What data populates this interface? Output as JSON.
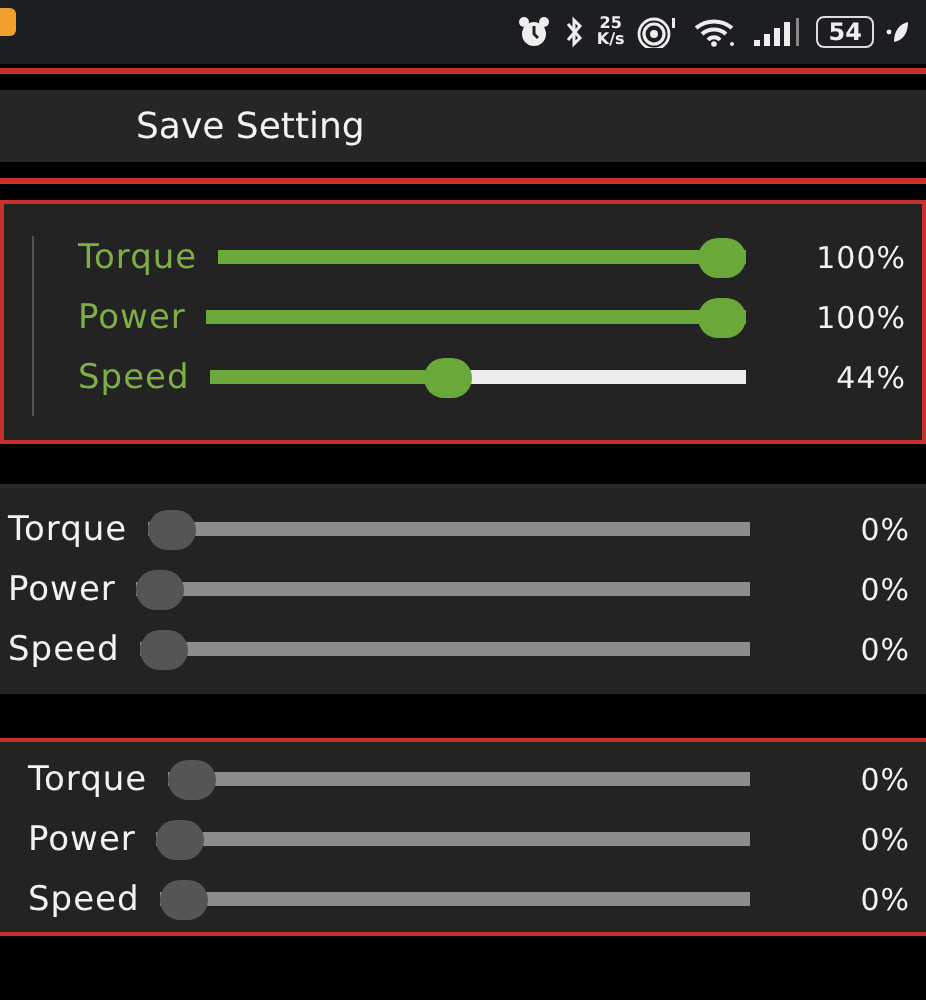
{
  "status_bar": {
    "net_speed_value": "25",
    "net_speed_unit": "K/s",
    "battery": "54"
  },
  "save_button": {
    "label": "Save Setting"
  },
  "groups": [
    {
      "enabled": true,
      "sliders": [
        {
          "label": "Torque",
          "level": 1,
          "reading": "100%"
        },
        {
          "label": "Power",
          "level": 1,
          "reading": "100%"
        },
        {
          "label": "Speed",
          "level": 0.44,
          "reading": "44%"
        }
      ]
    },
    {
      "enabled": false,
      "sliders": [
        {
          "label": "Torque",
          "level": 0,
          "reading": "0%"
        },
        {
          "label": "Power",
          "level": 0,
          "reading": "0%"
        },
        {
          "label": "Speed",
          "level": 0,
          "reading": "0%"
        }
      ]
    },
    {
      "enabled": false,
      "sliders": [
        {
          "label": "Torque",
          "level": 0,
          "reading": "0%"
        },
        {
          "label": "Power",
          "level": 0,
          "reading": "0%"
        },
        {
          "label": "Speed",
          "level": 0,
          "reading": "0%"
        }
      ]
    }
  ]
}
